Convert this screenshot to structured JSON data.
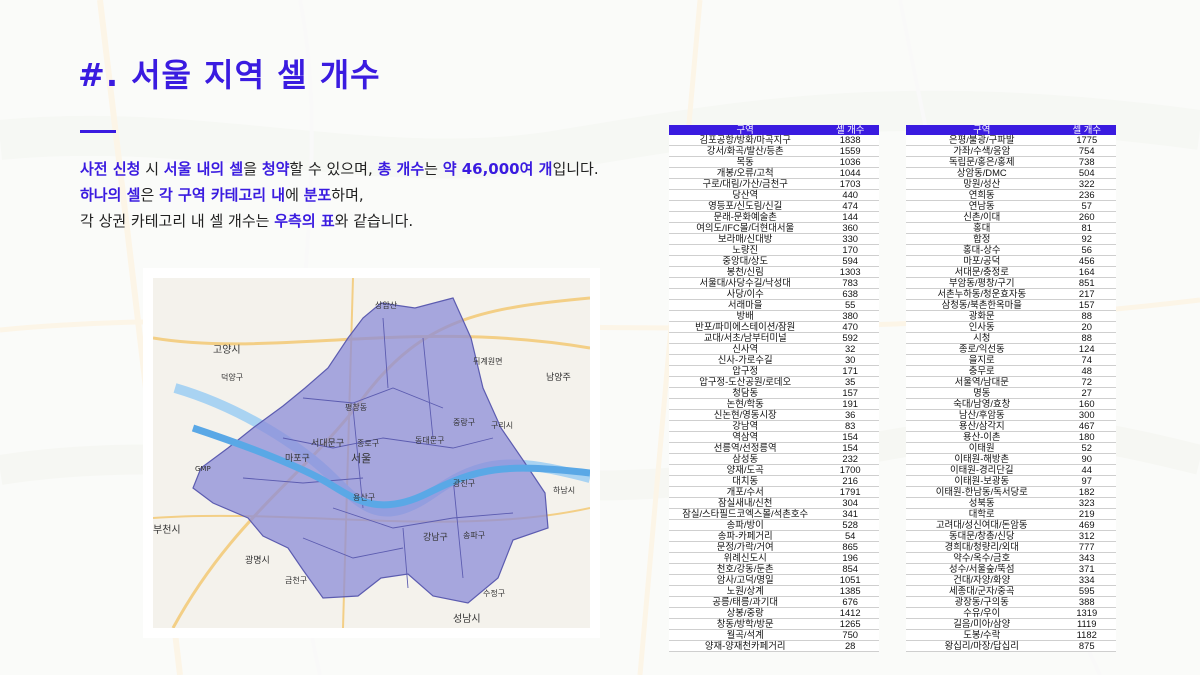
{
  "title": "#. 서울 지역 셀 개수",
  "desc": {
    "line1": [
      {
        "t": "사전 신청",
        "h": true
      },
      {
        "t": " 시 ",
        "h": false
      },
      {
        "t": "서울 내의 셀",
        "h": true
      },
      {
        "t": "을 ",
        "h": false
      },
      {
        "t": "청약",
        "h": true
      },
      {
        "t": "할 수 있으며, ",
        "h": false
      },
      {
        "t": "총 개수",
        "h": true
      },
      {
        "t": "는 ",
        "h": false
      },
      {
        "t": "약 46,000여 개",
        "h": true
      },
      {
        "t": "입니다.",
        "h": false
      }
    ],
    "line2": [
      {
        "t": "하나의 셀",
        "h": true
      },
      {
        "t": "은 ",
        "h": false
      },
      {
        "t": "각 구역 카테고리 내",
        "h": true
      },
      {
        "t": "에 ",
        "h": false
      },
      {
        "t": "분포",
        "h": true
      },
      {
        "t": "하며,",
        "h": false
      }
    ],
    "line3": [
      {
        "t": "각 상권 카테고리 내 셀 개수는 ",
        "h": false
      },
      {
        "t": "우측의 표",
        "h": true
      },
      {
        "t": "와 같습니다.",
        "h": false
      }
    ]
  },
  "map_labels": {
    "goyang": "고양시",
    "deokyang": "덕양구",
    "uijeongbu": "의정부",
    "dongducheon": "뒤계원면",
    "namyangju": "남양주",
    "pyeongchang": "평창동",
    "seodaemun": "서대문구",
    "jongno": "종로구",
    "dongdaemun": "동대문구",
    "jungnang": "중랑구",
    "guri": "구리시",
    "mapo": "마포구",
    "seoul": "서울",
    "yongsan": "용산구",
    "gwangjin": "광진구",
    "hanam": "하남시",
    "bucheon": "부천시",
    "gwangmyeong": "광명시",
    "geumcheon": "금천구",
    "gangnam": "강남구",
    "songpa": "송파구",
    "seongnam": "성남시",
    "sujeong": "수정구",
    "gmp": "GMP",
    "bucheon_bg": "부천시",
    "seongnam_bg": "소홀읍",
    "wayang": "상암산"
  },
  "table_header": {
    "area": "구역",
    "count": "셀 개수"
  },
  "table_left": [
    [
      "김포공항/방화/마곡지구",
      "1838"
    ],
    [
      "강서/화곡/발산/등촌",
      "1559"
    ],
    [
      "목동",
      "1036"
    ],
    [
      "개봉/오류/고척",
      "1044"
    ],
    [
      "구로/대림/가산/금천구",
      "1703"
    ],
    [
      "당산역",
      "440"
    ],
    [
      "영등포/신도림/신길",
      "474"
    ],
    [
      "문래-문화예술촌",
      "144"
    ],
    [
      "여의도/IFC몰/더현대서울",
      "360"
    ],
    [
      "보라매/신대방",
      "330"
    ],
    [
      "노량진",
      "170"
    ],
    [
      "중앙대/상도",
      "594"
    ],
    [
      "봉천/신림",
      "1303"
    ],
    [
      "서울대/사당수길/낙성대",
      "783"
    ],
    [
      "사당/이수",
      "638"
    ],
    [
      "서래마을",
      "55"
    ],
    [
      "방배",
      "380"
    ],
    [
      "반포/파미에스테이션/잠원",
      "470"
    ],
    [
      "교대/서초/남부터미널",
      "592"
    ],
    [
      "신사역",
      "32"
    ],
    [
      "신사-가로수길",
      "30"
    ],
    [
      "압구정",
      "171"
    ],
    [
      "압구정-도산공원/로데오",
      "35"
    ],
    [
      "청담동",
      "157"
    ],
    [
      "논현/학동",
      "191"
    ],
    [
      "신논현/영동시장",
      "36"
    ],
    [
      "강남역",
      "83"
    ],
    [
      "역삼역",
      "154"
    ],
    [
      "선릉역/선정릉역",
      "154"
    ],
    [
      "삼성동",
      "232"
    ],
    [
      "양재/도곡",
      "1700"
    ],
    [
      "대치동",
      "216"
    ],
    [
      "개포/수서",
      "1791"
    ],
    [
      "잠실새내/신천",
      "304"
    ],
    [
      "잠실/스타필드코엑스몰/석촌호수",
      "341"
    ],
    [
      "송파/방이",
      "528"
    ],
    [
      "송파-카페거리",
      "54"
    ],
    [
      "문정/가락/거여",
      "865"
    ],
    [
      "위례신도시",
      "196"
    ],
    [
      "천호/강동/둔촌",
      "854"
    ],
    [
      "암사/고덕/명일",
      "1051"
    ],
    [
      "노원/상계",
      "1385"
    ],
    [
      "공릉/태릉/과기대",
      "676"
    ],
    [
      "상봉/중랑",
      "1412"
    ],
    [
      "창동/방학/방문",
      "1265"
    ],
    [
      "월곡/석계",
      "750"
    ],
    [
      "양재-양재천카페거리",
      "28"
    ]
  ],
  "table_right": [
    [
      "은평/불광/구파발",
      "1775"
    ],
    [
      "가좌/수색/응암",
      "754"
    ],
    [
      "독립문/홍은/홍제",
      "738"
    ],
    [
      "상암동/DMC",
      "504"
    ],
    [
      "망원/성산",
      "322"
    ],
    [
      "연희동",
      "236"
    ],
    [
      "연남동",
      "57"
    ],
    [
      "신촌/이대",
      "260"
    ],
    [
      "홍대",
      "81"
    ],
    [
      "합정",
      "92"
    ],
    [
      "홍대-상수",
      "56"
    ],
    [
      "마포/공덕",
      "456"
    ],
    [
      "서대문/충정로",
      "164"
    ],
    [
      "부암동/평창/구기",
      "851"
    ],
    [
      "서촌누하동/청운효자동",
      "217"
    ],
    [
      "삼청동/북촌한옥마을",
      "157"
    ],
    [
      "광화문",
      "88"
    ],
    [
      "인사동",
      "20"
    ],
    [
      "시청",
      "88"
    ],
    [
      "종로/익선동",
      "124"
    ],
    [
      "을지로",
      "74"
    ],
    [
      "충무로",
      "48"
    ],
    [
      "서울역/남대문",
      "72"
    ],
    [
      "명동",
      "27"
    ],
    [
      "숙대/남영/효창",
      "160"
    ],
    [
      "남산/후암동",
      "300"
    ],
    [
      "용산/삼각지",
      "467"
    ],
    [
      "용산-이촌",
      "180"
    ],
    [
      "이태원",
      "52"
    ],
    [
      "이태원-해방촌",
      "90"
    ],
    [
      "이태원-경리단길",
      "44"
    ],
    [
      "이태원-보광동",
      "97"
    ],
    [
      "이태원-한남동/독서당로",
      "182"
    ],
    [
      "성북동",
      "323"
    ],
    [
      "대학로",
      "219"
    ],
    [
      "고려대/성신여대/돈암동",
      "469"
    ],
    [
      "동대문/창총/신당",
      "312"
    ],
    [
      "경희대/청량리/외대",
      "777"
    ],
    [
      "약수/옥수/금호",
      "343"
    ],
    [
      "성수/서울숲/뚝섬",
      "371"
    ],
    [
      "건대/자양/화양",
      "334"
    ],
    [
      "세종대/군자/중곡",
      "595"
    ],
    [
      "광장동/구의동",
      "388"
    ],
    [
      "수유/우이",
      "1319"
    ],
    [
      "길음/미아/삼양",
      "1119"
    ],
    [
      "도봉/수락",
      "1182"
    ],
    [
      "왕십리/마장/답십리",
      "875"
    ]
  ],
  "colors": {
    "accent": "#3a1be0",
    "seoul_fill": "#8c8cd8",
    "river": "#5aa8e6"
  }
}
